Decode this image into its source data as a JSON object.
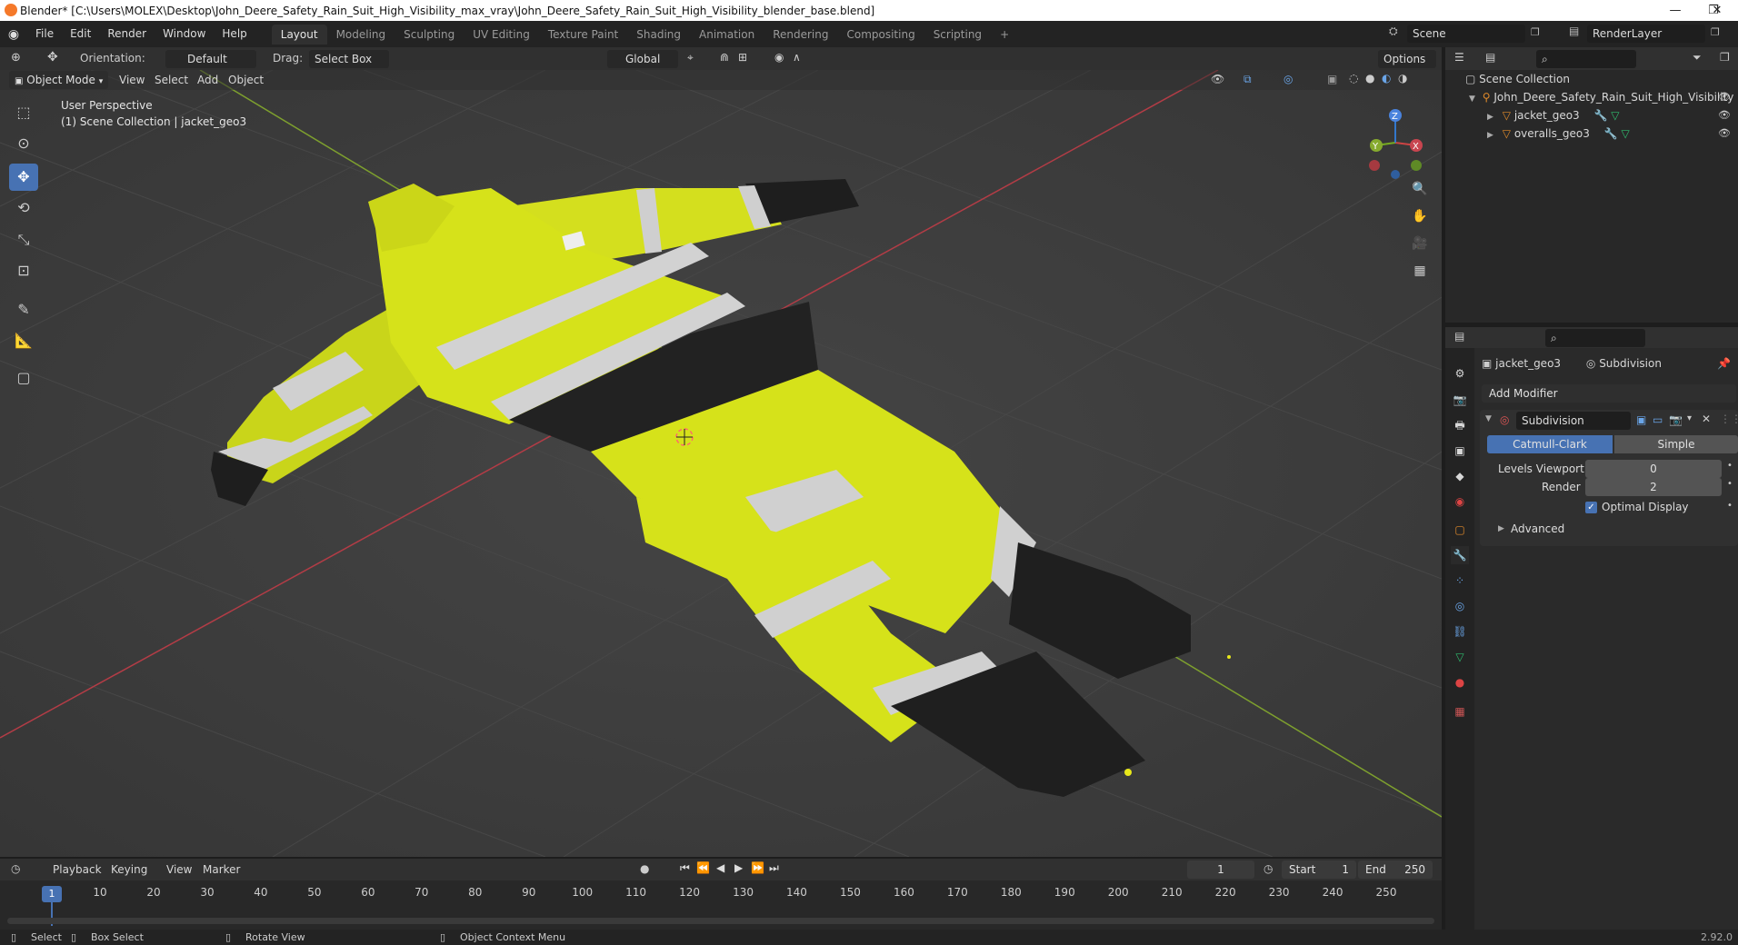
{
  "window": {
    "title": "Blender* [C:\\Users\\MOLEX\\Desktop\\John_Deere_Safety_Rain_Suit_High_Visibility_max_vray\\John_Deere_Safety_Rain_Suit_High_Visibility_blender_base.blend]",
    "minimize": "—",
    "maximize": "❐",
    "close": "✕"
  },
  "menu": [
    "File",
    "Edit",
    "Render",
    "Window",
    "Help"
  ],
  "workspaces": [
    "Layout",
    "Modeling",
    "Sculpting",
    "UV Editing",
    "Texture Paint",
    "Shading",
    "Animation",
    "Rendering",
    "Compositing",
    "Scripting"
  ],
  "workspace_add": "+",
  "scene": {
    "label": "Scene",
    "renderlayer": "RenderLayer"
  },
  "tool_header": {
    "orientation_label": "Orientation:",
    "orientation_value": "Default",
    "drag_label": "Drag:",
    "drag_value": "Select Box",
    "transform_orientation": "Global",
    "options": "Options"
  },
  "view_header": {
    "mode": "Object Mode",
    "menus": [
      "View",
      "Select",
      "Add",
      "Object"
    ]
  },
  "viewport": {
    "perspective": "User Perspective",
    "collection": "(1) Scene Collection | jacket_geo3"
  },
  "gizmo": {
    "x": "X",
    "y": "Y",
    "z": "Z"
  },
  "outliner": {
    "root": "Scene Collection",
    "collection": "John_Deere_Safety_Rain_Suit_High_Visibility",
    "objects": [
      "jacket_geo3",
      "overalls_geo3"
    ]
  },
  "properties": {
    "object": "jacket_geo3",
    "modifier_crumb": "Subdivision",
    "add_modifier": "Add Modifier",
    "modifier_name": "Subdivision",
    "method_a": "Catmull-Clark",
    "method_b": "Simple",
    "levels_viewport_label": "Levels Viewport",
    "levels_viewport": "0",
    "render_label": "Render",
    "render_value": "2",
    "optimal_display": "Optimal Display",
    "advanced": "Advanced"
  },
  "timeline": {
    "menus": [
      "Playback",
      "Keying",
      "View",
      "Marker"
    ],
    "current_frame": "1",
    "start_label": "Start",
    "start": "1",
    "end_label": "End",
    "end": "250",
    "ruler_labels": [
      "1",
      "10",
      "20",
      "30",
      "40",
      "50",
      "60",
      "70",
      "80",
      "90",
      "100",
      "110",
      "120",
      "130",
      "140",
      "150",
      "160",
      "170",
      "180",
      "190",
      "200",
      "210",
      "220",
      "230",
      "240",
      "250"
    ]
  },
  "status": {
    "select": "Select",
    "box_select": "Box Select",
    "rotate_view": "Rotate View",
    "context_menu": "Object Context Menu",
    "version": "2.92.0"
  },
  "colors": {
    "accent": "#4772b3",
    "suit_yellow": "#d6e21a",
    "suit_black": "#1c1c1c",
    "reflective": "#c8c8c8",
    "axis_x": "#b33c46",
    "axis_y": "#7ea02e"
  }
}
